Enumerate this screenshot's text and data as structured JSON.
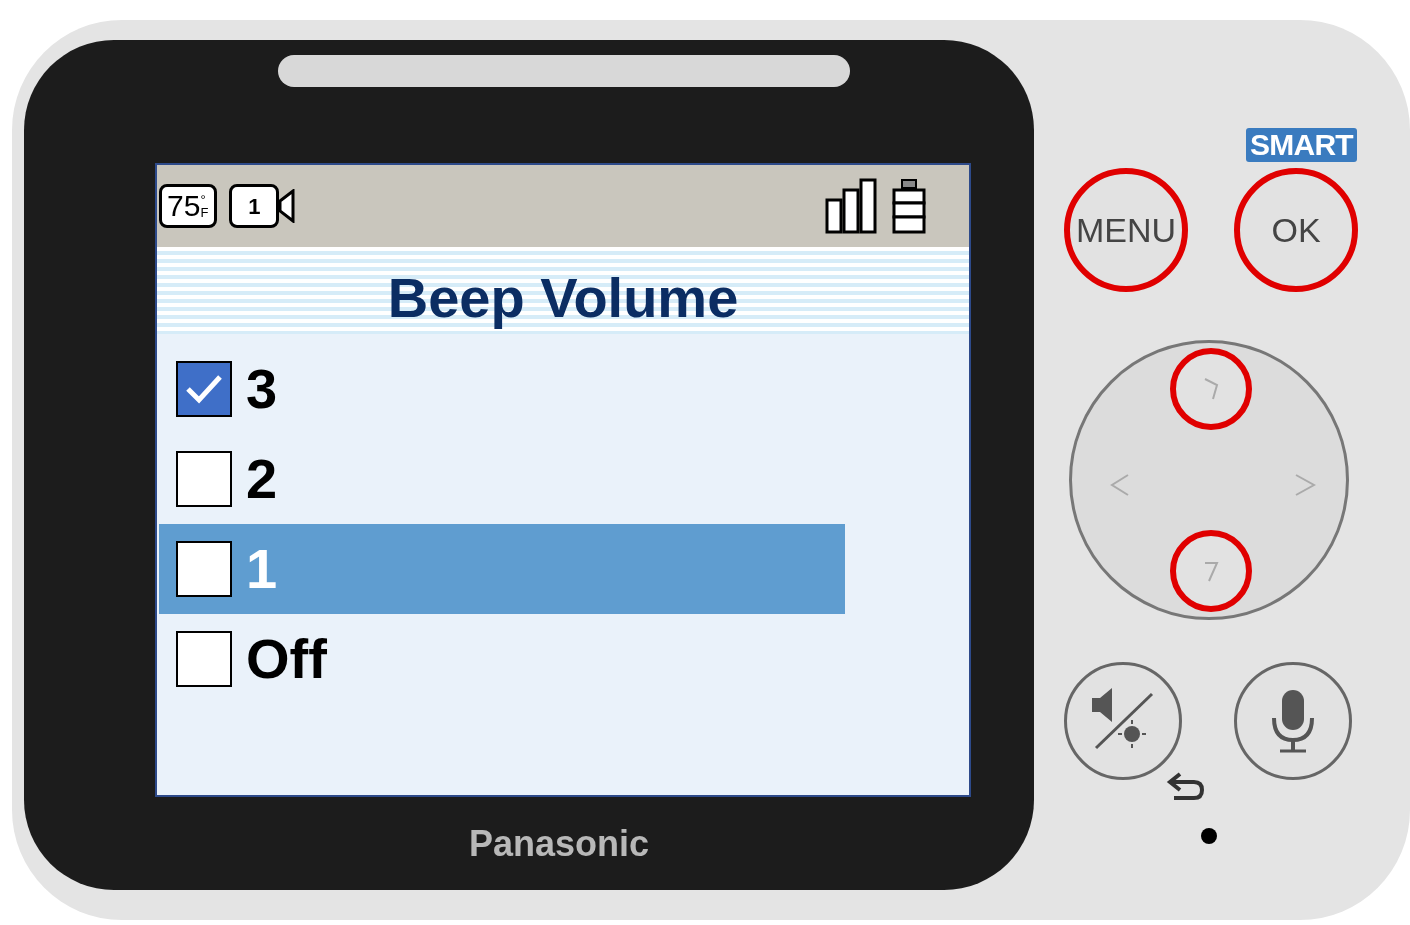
{
  "device": {
    "brand": "Panasonic",
    "smart_label": "SMART"
  },
  "status_bar": {
    "temperature": "75",
    "temp_unit": "°F",
    "camera_number": "1"
  },
  "screen": {
    "title": "Beep Volume",
    "options": [
      {
        "label": "3",
        "checked": true,
        "selected": false
      },
      {
        "label": "2",
        "checked": false,
        "selected": false
      },
      {
        "label": "1",
        "checked": false,
        "selected": true
      },
      {
        "label": "Off",
        "checked": false,
        "selected": false
      }
    ]
  },
  "buttons": [
    {
      "kind": "menu",
      "label": "MENU",
      "highlighted": true
    },
    {
      "kind": "ok",
      "label": "OK",
      "highlighted": true
    },
    {
      "kind": "up",
      "highlighted": true
    },
    {
      "kind": "down",
      "highlighted": true
    },
    {
      "kind": "left",
      "highlighted": false
    },
    {
      "kind": "right",
      "highlighted": false
    },
    {
      "kind": "mute",
      "highlighted": false
    },
    {
      "kind": "talk",
      "highlighted": false
    }
  ]
}
